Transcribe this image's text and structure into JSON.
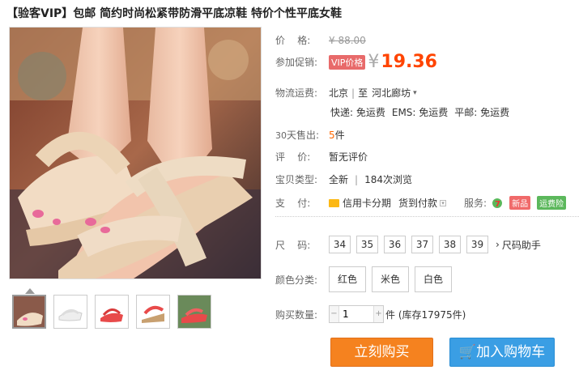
{
  "product": {
    "title": "【验客VIP】包邮 简约时尚松紧带防滑平底凉鞋 特价个性平底女鞋"
  },
  "price": {
    "label": "价    格:",
    "old": "¥ 88.00"
  },
  "promo": {
    "label": "参加促销:",
    "badge": "VIP价格",
    "yen": "¥",
    "value": "19.36"
  },
  "shipping": {
    "label": "物流运费:",
    "from": "北京",
    "sep": "|",
    "to_prefix": "至",
    "to": "河北廊坊",
    "express": "快递: 免运费",
    "ems": "EMS: 免运费",
    "mail": "平邮: 免运费"
  },
  "sales": {
    "label_num": "30",
    "label": "天售出:",
    "count": "5",
    "unit": "件"
  },
  "review": {
    "label": "评    价:",
    "value": "暂无评价"
  },
  "condition": {
    "label": "宝贝类型:",
    "value": "全新",
    "sep": "|",
    "views": "184次浏览"
  },
  "payment": {
    "label": "支    付:",
    "credit": "信用卡分期",
    "cod": "货到付款",
    "service_label": "服务:",
    "service_num": "7",
    "tag_new": "新品",
    "tag_ship": "运费险"
  },
  "size": {
    "label": "尺    码:",
    "options": [
      "34",
      "35",
      "36",
      "37",
      "38",
      "39"
    ],
    "helper": "尺码助手"
  },
  "color": {
    "label": "颜色分类:",
    "options": [
      "红色",
      "米色",
      "白色"
    ]
  },
  "quantity": {
    "label": "购买数量:",
    "value": "1",
    "stock": "件 (库存17975件)"
  },
  "actions": {
    "buy": "立刻购买",
    "cart": "加入购物车"
  },
  "colors": {
    "accent_price": "#ff4400",
    "buy_button": "#f5821f",
    "cart_button": "#3a9ee4"
  }
}
